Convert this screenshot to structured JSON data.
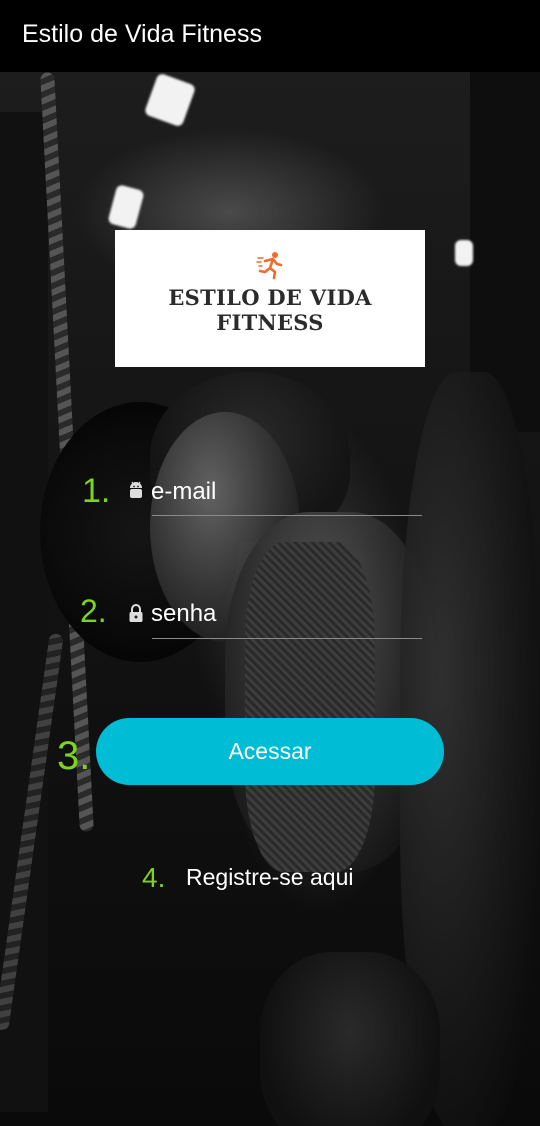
{
  "appbar": {
    "title": "Estilo de Vida Fitness"
  },
  "logo": {
    "text": "ESTILO DE VIDA FITNESS",
    "icon": "running-person-icon",
    "icon_color": "#f26a2e"
  },
  "form": {
    "steps": [
      "1.",
      "2.",
      "3.",
      "4."
    ],
    "email": {
      "placeholder": "e-mail",
      "icon": "android-icon"
    },
    "password": {
      "placeholder": "senha",
      "icon": "lock-icon"
    },
    "submit_label": "Acessar",
    "register_label": "Registre-se aqui"
  },
  "colors": {
    "accent": "#00bcd4",
    "step_number": "#7ed321",
    "appbar": "#000000"
  }
}
